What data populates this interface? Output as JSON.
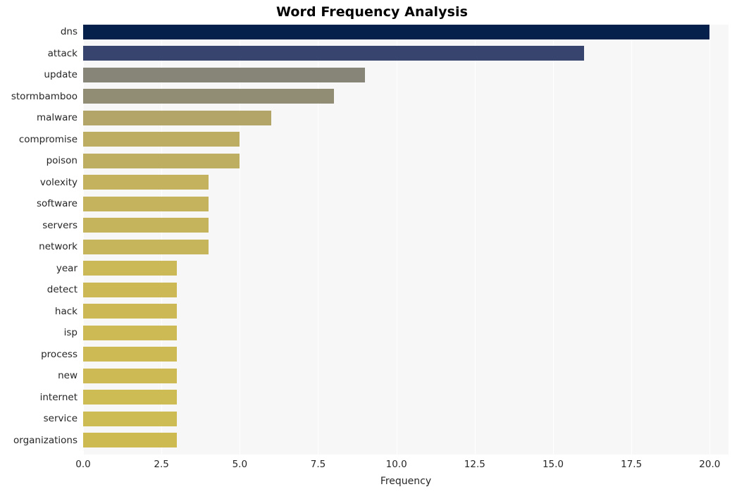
{
  "chart_data": {
    "type": "bar",
    "orientation": "horizontal",
    "title": "Word Frequency Analysis",
    "xlabel": "Frequency",
    "ylabel": "",
    "xlim": [
      0,
      20.6
    ],
    "xticks": [
      "0.0",
      "2.5",
      "5.0",
      "7.5",
      "10.0",
      "12.5",
      "15.0",
      "17.5",
      "20.0"
    ],
    "xtick_values": [
      0,
      2.5,
      5,
      7.5,
      10,
      12.5,
      15,
      17.5,
      20
    ],
    "grid": true,
    "grid_axis": "x",
    "legend": "none",
    "categories": [
      "dns",
      "attack",
      "update",
      "stormbamboo",
      "malware",
      "compromise",
      "poison",
      "volexity",
      "software",
      "servers",
      "network",
      "year",
      "detect",
      "hack",
      "isp",
      "process",
      "new",
      "internet",
      "service",
      "organizations"
    ],
    "values": [
      20,
      16,
      9,
      8,
      6,
      5,
      5,
      4,
      4,
      4,
      3,
      3,
      3,
      3,
      3,
      3,
      3,
      3,
      3,
      3
    ],
    "bars": [
      {
        "label": "dns",
        "value": 20,
        "color": "#05204a"
      },
      {
        "label": "attack",
        "value": 16,
        "color": "#37456e"
      },
      {
        "label": "update",
        "value": 9,
        "color": "#878578"
      },
      {
        "label": "stormbamboo",
        "value": 8,
        "color": "#918d75"
      },
      {
        "label": "malware",
        "value": 6,
        "color": "#b2a567"
      },
      {
        "label": "compromise",
        "value": 5,
        "color": "#bcad62"
      },
      {
        "label": "poison",
        "value": 5,
        "color": "#bdae62"
      },
      {
        "label": "volexity",
        "value": 4,
        "color": "#c4b25e"
      },
      {
        "label": "software",
        "value": 4,
        "color": "#c5b35d"
      },
      {
        "label": "servers",
        "value": 4,
        "color": "#c6b45c"
      },
      {
        "label": "network",
        "value": 4,
        "color": "#c7b55b"
      },
      {
        "label": "year",
        "value": 3,
        "color": "#cbb857"
      },
      {
        "label": "detect",
        "value": 3,
        "color": "#ccb956"
      },
      {
        "label": "hack",
        "value": 3,
        "color": "#ccb955"
      },
      {
        "label": "isp",
        "value": 3,
        "color": "#cdba55"
      },
      {
        "label": "process",
        "value": 3,
        "color": "#cdba54"
      },
      {
        "label": "new",
        "value": 3,
        "color": "#cdba54"
      },
      {
        "label": "internet",
        "value": 3,
        "color": "#cdbb53"
      },
      {
        "label": "service",
        "value": 3,
        "color": "#cdbb53"
      },
      {
        "label": "organizations",
        "value": 3,
        "color": "#cdbb52"
      }
    ],
    "colors": {
      "plot_background": "#f7f7f7",
      "figure_background": "#ffffff",
      "gridline": "#ffffff",
      "text": "#262626",
      "title": "#000000"
    }
  }
}
